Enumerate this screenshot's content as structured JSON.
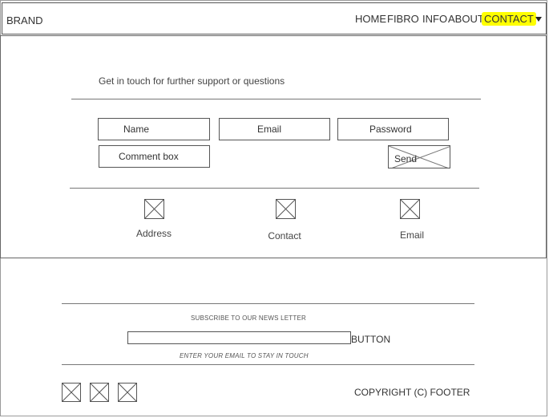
{
  "nav": {
    "brand": "BRAND",
    "items": [
      {
        "label": "HOME"
      },
      {
        "label": "FIBRO"
      },
      {
        "label": "INFO"
      },
      {
        "label": "ABOUT"
      },
      {
        "label": "CONTACT",
        "highlighted": true
      }
    ],
    "highlight_color": "#ffff00"
  },
  "contact": {
    "intro": "Get in touch for further support or questions",
    "fields": {
      "name": "Name",
      "email": "Email",
      "password": "Password",
      "comment": "Comment box"
    },
    "send_label": "Send",
    "info": [
      {
        "label": "Address",
        "icon": "image-placeholder-icon"
      },
      {
        "label": "Contact",
        "icon": "image-placeholder-icon"
      },
      {
        "label": "Email",
        "icon": "image-placeholder-icon"
      }
    ]
  },
  "newsletter": {
    "heading": "SUBSCRIBE TO OUR NEWS LETTER",
    "button_label": "BUTTON",
    "hint": "ENTER YOUR EMAIL TO STAY IN TOUCH",
    "input_value": ""
  },
  "footer": {
    "social_icons": [
      "image-placeholder-icon",
      "image-placeholder-icon",
      "image-placeholder-icon"
    ],
    "copyright": "COPYRIGHT (C) FOOTER"
  }
}
